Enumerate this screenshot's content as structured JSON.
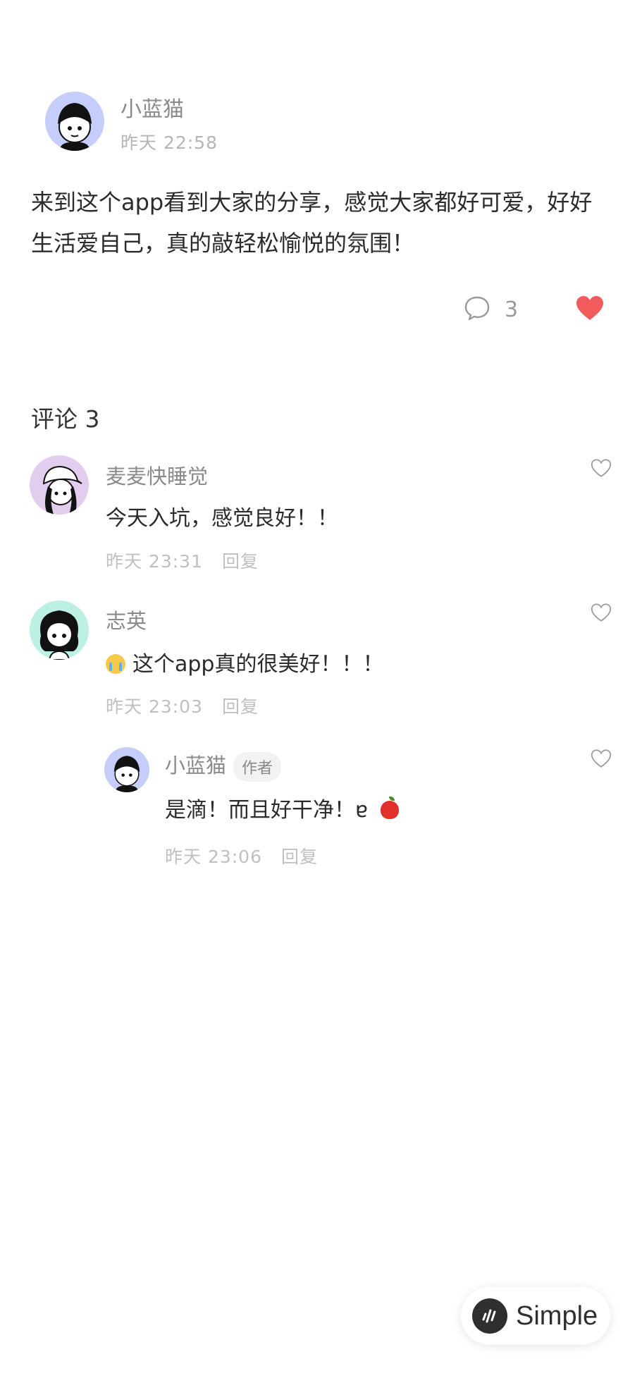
{
  "post": {
    "author": "小蓝猫",
    "time": "昨天 22:58",
    "body": "来到这个app看到大家的分享，感觉大家都好可爱，好好生活爱自己，真的敲轻松愉悦的氛围！",
    "comment_count": "3",
    "liked": true
  },
  "comments_section": {
    "title": "评论 3",
    "items": [
      {
        "name": "麦麦快睡觉",
        "text": "今天入坑，感觉良好！！",
        "time": "昨天 23:31",
        "reply": "回复"
      },
      {
        "name": "志英",
        "text": "这个app真的很美好！！！",
        "time": "昨天 23:03",
        "reply": "回复"
      }
    ],
    "reply": {
      "name": "小蓝猫",
      "badge": "作者",
      "text": "是滴！而且好干净！ɐ ",
      "time": "昨天 23:06",
      "reply": "回复"
    }
  },
  "fab": {
    "label": "Simple"
  },
  "colors": {
    "heart_liked": "#f25b5b",
    "avatar_blue": "#c5cdfb",
    "avatar_purple": "#e3cdef",
    "avatar_teal": "#bdf0e4"
  }
}
